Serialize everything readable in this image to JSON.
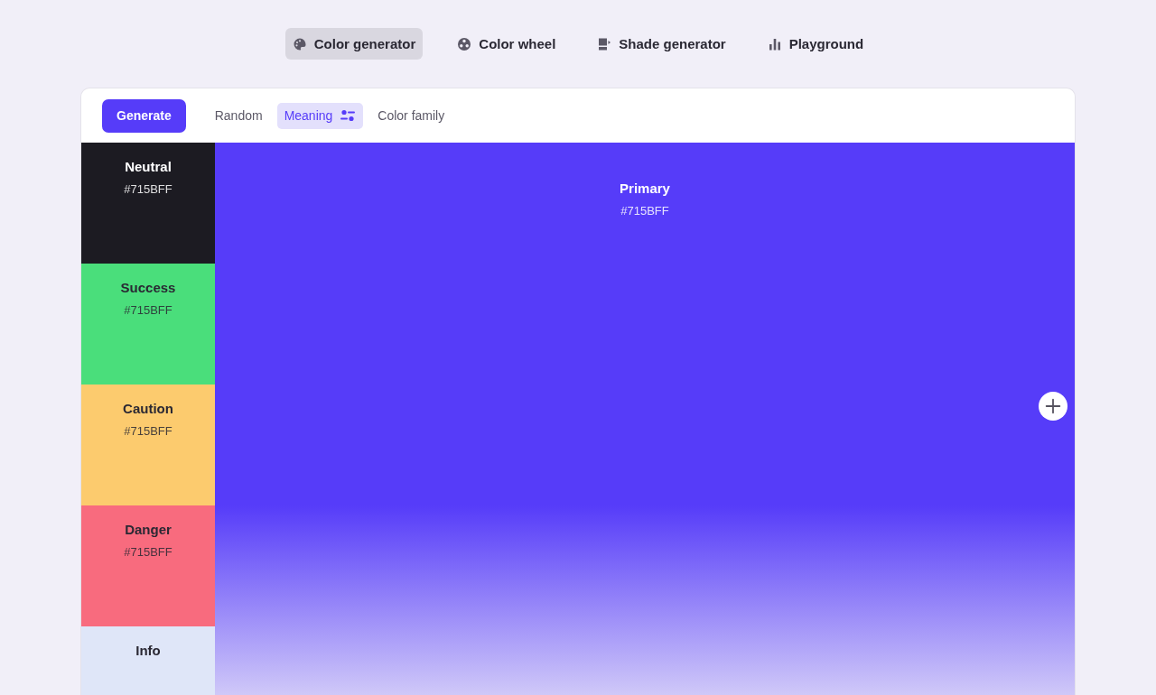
{
  "nav": [
    {
      "label": "Color generator",
      "kind": "palette",
      "selected": true
    },
    {
      "label": "Color wheel",
      "kind": "wheel",
      "selected": false
    },
    {
      "label": "Shade generator",
      "kind": "shade",
      "selected": false
    },
    {
      "label": "Playground",
      "kind": "bars",
      "selected": false
    }
  ],
  "toolbar": {
    "generate": "Generate",
    "modes": [
      {
        "label": "Random",
        "selected": false,
        "has_settings": false
      },
      {
        "label": "Meaning",
        "selected": true,
        "has_settings": true
      },
      {
        "label": "Color family",
        "selected": false,
        "has_settings": false
      }
    ]
  },
  "swatches": [
    {
      "name": "Neutral",
      "hex": "#715BFF",
      "color": "#1c1b22",
      "dark_text": false
    },
    {
      "name": "Success",
      "hex": "#715BFF",
      "color": "#4ade7b",
      "dark_text": true
    },
    {
      "name": "Caution",
      "hex": "#715BFF",
      "color": "#fccb6e",
      "dark_text": true
    },
    {
      "name": "Danger",
      "hex": "#715BFF",
      "color": "#f86b7e",
      "dark_text": true
    },
    {
      "name": "Info",
      "color": "#dfe6f8",
      "dark_text": true
    }
  ],
  "primary": {
    "name": "Primary",
    "hex": "#715BFF",
    "color": "#563cf9"
  }
}
